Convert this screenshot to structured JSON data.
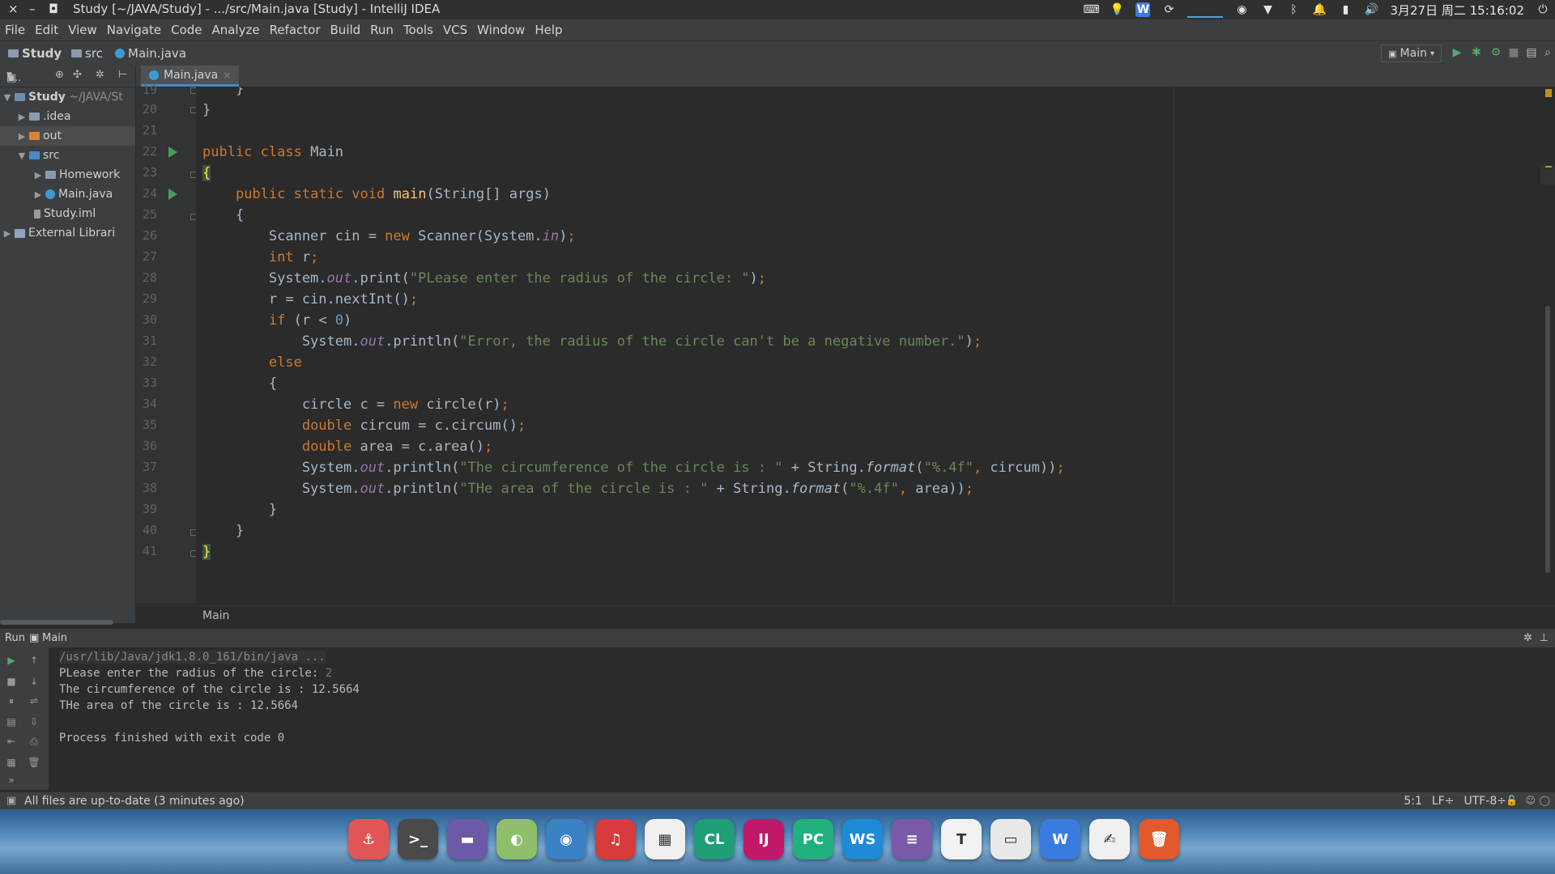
{
  "window": {
    "title": "Study [~/JAVA/Study] - .../src/Main.java [Study] - IntelliJ IDEA",
    "close": "×",
    "minimize": "–",
    "maximize": "◘"
  },
  "tray": {
    "date_time": "3月27日 周二 15:16:02",
    "icons": [
      "keyboard-icon",
      "lightbulb-icon",
      "wps-icon",
      "sync-icon",
      "network-graph-icon",
      "message-icon",
      "wifi-icon",
      "bluetooth-icon",
      "bell-icon",
      "battery-icon",
      "volume-icon",
      "power-icon"
    ]
  },
  "menu": [
    "File",
    "Edit",
    "View",
    "Navigate",
    "Code",
    "Analyze",
    "Refactor",
    "Build",
    "Run",
    "Tools",
    "VCS",
    "Window",
    "Help"
  ],
  "navbar": {
    "project": "Study",
    "folder": "src",
    "file": "Main.java",
    "run_config": "Main"
  },
  "project_panel": {
    "label": "P...",
    "tree": [
      {
        "label": "Study",
        "extra": "~/JAVA/St",
        "level": 0,
        "expanded": true,
        "type": "module"
      },
      {
        "label": ".idea",
        "level": 1,
        "expanded": false,
        "type": "folder"
      },
      {
        "label": "out",
        "level": 1,
        "expanded": false,
        "type": "folder-orange"
      },
      {
        "label": "src",
        "level": 1,
        "expanded": true,
        "type": "folder-blue"
      },
      {
        "label": "Homework",
        "level": 2,
        "expanded": false,
        "type": "package"
      },
      {
        "label": "Main.java",
        "level": 2,
        "expanded": false,
        "type": "java"
      },
      {
        "label": "Study.iml",
        "level": 1,
        "type": "iml"
      },
      {
        "label": "External Librari",
        "level": 0,
        "expanded": false,
        "type": "library"
      }
    ]
  },
  "editor": {
    "tab": "Main.java",
    "breadcrumb": "Main",
    "line_numbers": [
      "19",
      "20",
      "21",
      "22",
      "23",
      "24",
      "25",
      "26",
      "27",
      "28",
      "29",
      "30",
      "31",
      "32",
      "33",
      "34",
      "35",
      "36",
      "37",
      "38",
      "39",
      "40",
      "41"
    ],
    "lines": [
      "    }",
      "}",
      "",
      "public class Main",
      "{",
      "    public static void main(String[] args)",
      "    {",
      "        Scanner cin = new Scanner(System.in);",
      "        int r;",
      "        System.out.print(\"PLease enter the radius of the circle: \");",
      "        r = cin.nextInt();",
      "        if (r < 0)",
      "            System.out.println(\"Error, the radius of the circle can't be a negative number.\");",
      "        else",
      "        {",
      "            circle c = new circle(r);",
      "            double circum = c.circum();",
      "            double area = c.area();",
      "            System.out.println(\"The circumference of the circle is : \" + String.format(\"%.4f\", circum));",
      "            System.out.println(\"THe area of the circle is : \" + String.format(\"%.4f\", area));",
      "        }",
      "    }",
      "}"
    ]
  },
  "run_panel": {
    "label": "Run",
    "config": "Main",
    "output": [
      "/usr/lib/Java/jdk1.8.0_161/bin/java ...",
      "PLease enter the radius of the circle: ",
      "The circumference of the circle is : 12.5664",
      "THe area of the circle is : 12.5664",
      "",
      "Process finished with exit code 0"
    ],
    "user_input": "2"
  },
  "status": {
    "message": "All files are up-to-date (3 minutes ago)",
    "position": "5:1",
    "line_sep": "LF÷",
    "encoding": "UTF-8÷"
  },
  "dock": [
    {
      "name": "anchor",
      "glyph": "⚓",
      "color": "#e05656"
    },
    {
      "name": "terminal",
      "glyph": ">_",
      "color": "#4a4a4a"
    },
    {
      "name": "files",
      "glyph": "▬",
      "color": "#6c5aa8"
    },
    {
      "name": "toggle",
      "glyph": "◐",
      "color": "#8fbf6a"
    },
    {
      "name": "chrome",
      "glyph": "◉",
      "color": "#3b82c4"
    },
    {
      "name": "netease-music",
      "glyph": "♫",
      "color": "#d83b3b"
    },
    {
      "name": "app-store",
      "glyph": "▦",
      "color": "#f0f0f0"
    },
    {
      "name": "clion",
      "glyph": "CL",
      "color": "#1f9e78"
    },
    {
      "name": "intellij",
      "glyph": "IJ",
      "color": "#c2176b"
    },
    {
      "name": "pycharm",
      "glyph": "PC",
      "color": "#22b07d"
    },
    {
      "name": "webstorm",
      "glyph": "WS",
      "color": "#1d8bd6"
    },
    {
      "name": "notes",
      "glyph": "≡",
      "color": "#7a5aa8"
    },
    {
      "name": "typora",
      "glyph": "T",
      "color": "#f2f2f2"
    },
    {
      "name": "remote-desktop",
      "glyph": "▭",
      "color": "#e8e8e8"
    },
    {
      "name": "wps",
      "glyph": "W",
      "color": "#3a7be0"
    },
    {
      "name": "pdf",
      "glyph": "✍",
      "color": "#f0f0f0"
    },
    {
      "name": "trash",
      "glyph": "🗑",
      "color": "#e05a2b"
    }
  ]
}
